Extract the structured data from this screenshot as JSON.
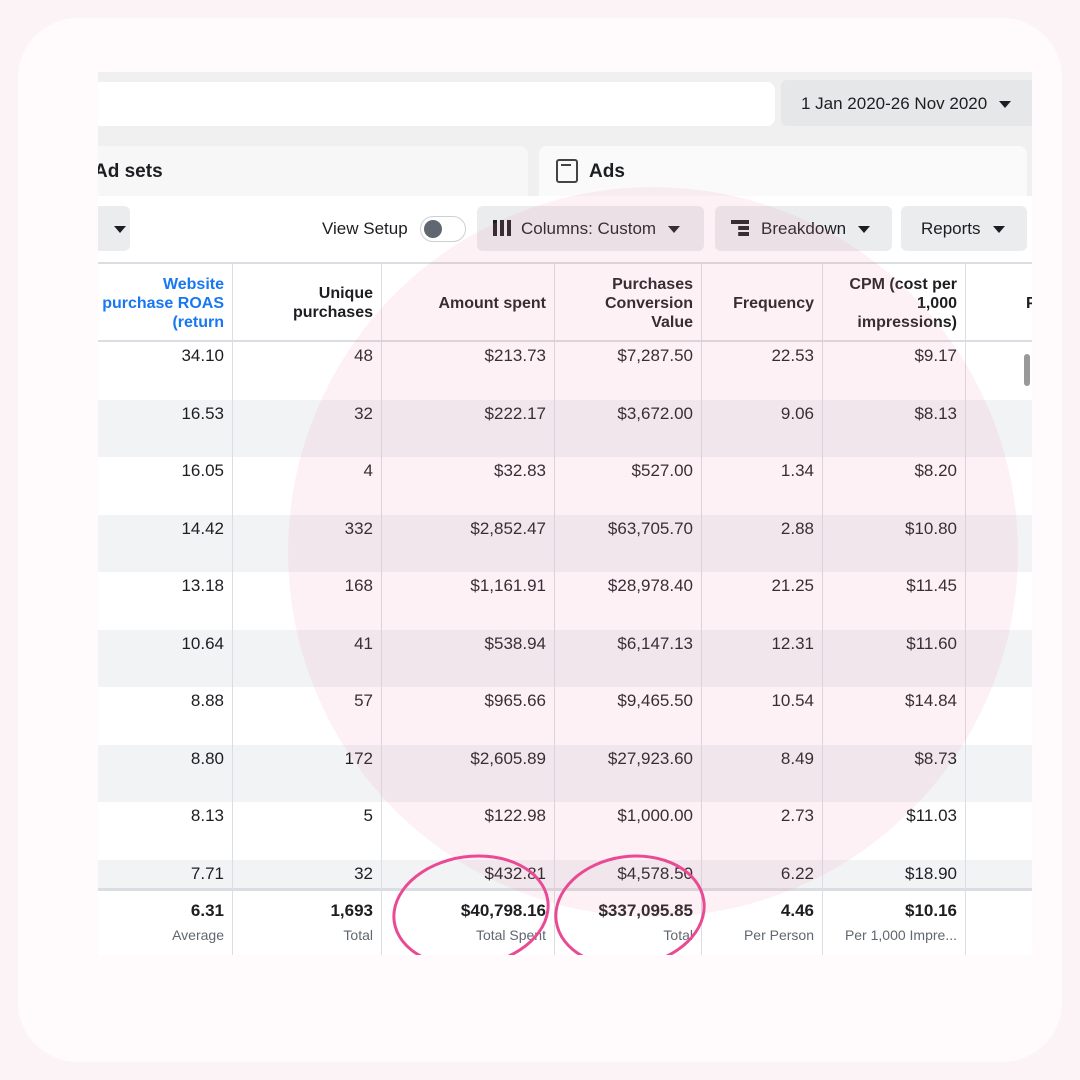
{
  "date_range": "1 Jan 2020-26 Nov 2020",
  "tabs": [
    {
      "label": "Ad sets"
    },
    {
      "label": "Ads"
    }
  ],
  "toolbar": {
    "view_setup": "View Setup",
    "columns": "Columns: Custom",
    "breakdown": "Breakdown",
    "reports": "Reports"
  },
  "columns": [
    "Website purchase ROAS (return",
    "Unique purchases",
    "Amount spent",
    "Purchases Conversion Value",
    "Frequency",
    "CPM (cost per 1,000 impressions)",
    "P"
  ],
  "rows": [
    [
      "34.10",
      "48",
      "$213.73",
      "$7,287.50",
      "22.53",
      "$9.17"
    ],
    [
      "16.53",
      "32",
      "$222.17",
      "$3,672.00",
      "9.06",
      "$8.13"
    ],
    [
      "16.05",
      "4",
      "$32.83",
      "$527.00",
      "1.34",
      "$8.20"
    ],
    [
      "14.42",
      "332",
      "$2,852.47",
      "$63,705.70",
      "2.88",
      "$10.80"
    ],
    [
      "13.18",
      "168",
      "$1,161.91",
      "$28,978.40",
      "21.25",
      "$11.45"
    ],
    [
      "10.64",
      "41",
      "$538.94",
      "$6,147.13",
      "12.31",
      "$11.60"
    ],
    [
      "8.88",
      "57",
      "$965.66",
      "$9,465.50",
      "10.54",
      "$14.84"
    ],
    [
      "8.80",
      "172",
      "$2,605.89",
      "$27,923.60",
      "8.49",
      "$8.73"
    ],
    [
      "8.13",
      "5",
      "$122.98",
      "$1,000.00",
      "2.73",
      "$11.03"
    ],
    [
      "7.71",
      "32",
      "$432.81",
      "$4,578.50",
      "6.22",
      "$18.90"
    ]
  ],
  "totals": [
    {
      "value": "6.31",
      "label": "Average"
    },
    {
      "value": "1,693",
      "label": "Total"
    },
    {
      "value": "$40,798.16",
      "label": "Total Spent"
    },
    {
      "value": "$337,095.85",
      "label": "Total"
    },
    {
      "value": "4.46",
      "label": "Per Person"
    },
    {
      "value": "$10.16",
      "label": "Per 1,000 Impre..."
    }
  ],
  "colors": {
    "link": "#1877f2",
    "highlight": "#e94a93"
  }
}
